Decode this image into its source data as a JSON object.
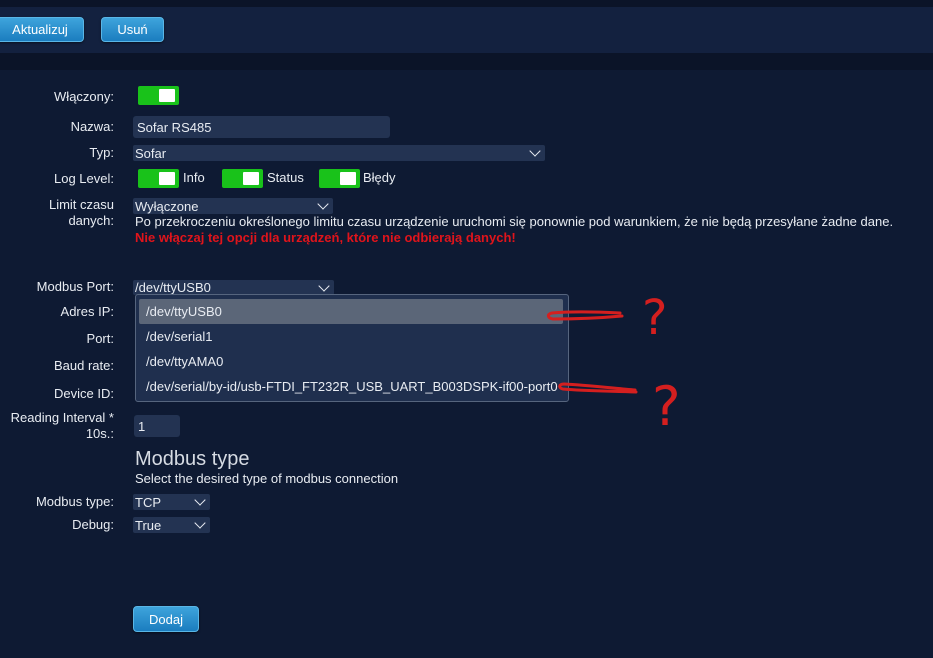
{
  "toolbar": {
    "update_label": "Aktualizuj",
    "delete_label": "Usuń"
  },
  "form": {
    "enabled": {
      "label": "Włączony:",
      "on": true
    },
    "name": {
      "label": "Nazwa:",
      "value": "Sofar RS485"
    },
    "type": {
      "label": "Typ:",
      "value": "Sofar"
    },
    "log_level": {
      "label": "Log Level:",
      "options": [
        {
          "name": "Info",
          "on": true
        },
        {
          "name": "Status",
          "on": true
        },
        {
          "name": "Błędy",
          "on": true
        }
      ]
    },
    "timeout": {
      "label_line1": "Limit czasu",
      "label_line2": "danych:",
      "value": "Wyłączone",
      "description": "Po przekroczeniu określonego limitu czasu urządzenie uruchomi się ponownie pod warunkiem, że nie będą przesyłane żadne dane.",
      "warning": "Nie włączaj tej opcji dla urządzeń, które nie odbierają danych!"
    },
    "modbus_port": {
      "label": "Modbus Port:",
      "value": "/dev/ttyUSB0",
      "options": [
        "/dev/ttyUSB0",
        "/dev/serial1",
        "/dev/ttyAMA0",
        "/dev/serial/by-id/usb-FTDI_FT232R_USB_UART_B003DSPK-if00-port0"
      ],
      "highlighted_index": 0
    },
    "ip_label": "Adres IP:",
    "port_label": "Port:",
    "baud_label": "Baud rate:",
    "device_label": "Device ID:",
    "reading_interval": {
      "label_line1": "Reading Interval *",
      "label_line2": "10s.:",
      "value": "1"
    },
    "modbus_type_section": {
      "heading": "Modbus type",
      "description": "Select the desired type of modbus connection"
    },
    "modbus_type": {
      "label": "Modbus type:",
      "value": "TCP"
    },
    "debug": {
      "label": "Debug:",
      "value": "True"
    },
    "add_label": "Dodaj"
  },
  "annotation": {
    "mark": "?",
    "color": "#d41f1f"
  },
  "colors": {
    "background": "#0e1a33",
    "toolbar": "#13213f",
    "input": "#233352",
    "toggle_on": "#19c21a",
    "button": "#2a8fd0",
    "warning": "#e0141b"
  }
}
